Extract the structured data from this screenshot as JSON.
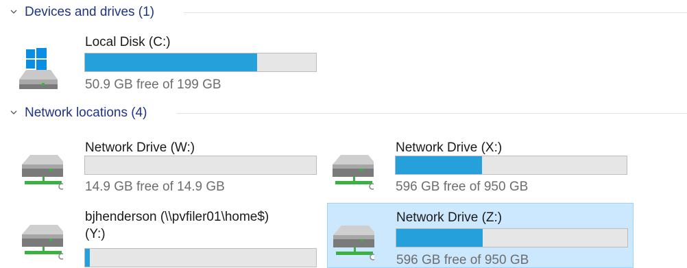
{
  "colors": {
    "group_header": "#1e3287",
    "bar_fill": "#26a0da",
    "bar_track": "#e6e6e6",
    "selected_bg": "#cce8ff",
    "selected_border": "#99d1ff"
  },
  "groups": [
    {
      "title": "Devices and drives (1)",
      "expanded": true,
      "drives": [
        {
          "name": "Local Disk (C:)",
          "free_text": "50.9 GB free of 199 GB",
          "used_fraction": 0.744,
          "icon": "windows-drive-icon",
          "selected": false
        }
      ]
    },
    {
      "title": "Network locations (4)",
      "expanded": true,
      "drives": [
        {
          "name": "Network Drive (W:)",
          "free_text": "14.9 GB free of 14.9 GB",
          "used_fraction": 0.0,
          "icon": "network-drive-icon",
          "selected": false
        },
        {
          "name": "Network Drive (X:)",
          "free_text": "596 GB free of 950 GB",
          "used_fraction": 0.373,
          "icon": "network-drive-icon",
          "selected": false
        },
        {
          "name": "bjhenderson (\\\\pvfiler01\\home$)",
          "name_line2": "(Y:)",
          "free_text": "",
          "used_fraction": 0.02,
          "icon": "network-drive-icon",
          "selected": false
        },
        {
          "name": "Network Drive (Z:)",
          "free_text": "596 GB free of 950 GB",
          "used_fraction": 0.373,
          "icon": "network-drive-icon",
          "selected": true
        }
      ]
    }
  ]
}
